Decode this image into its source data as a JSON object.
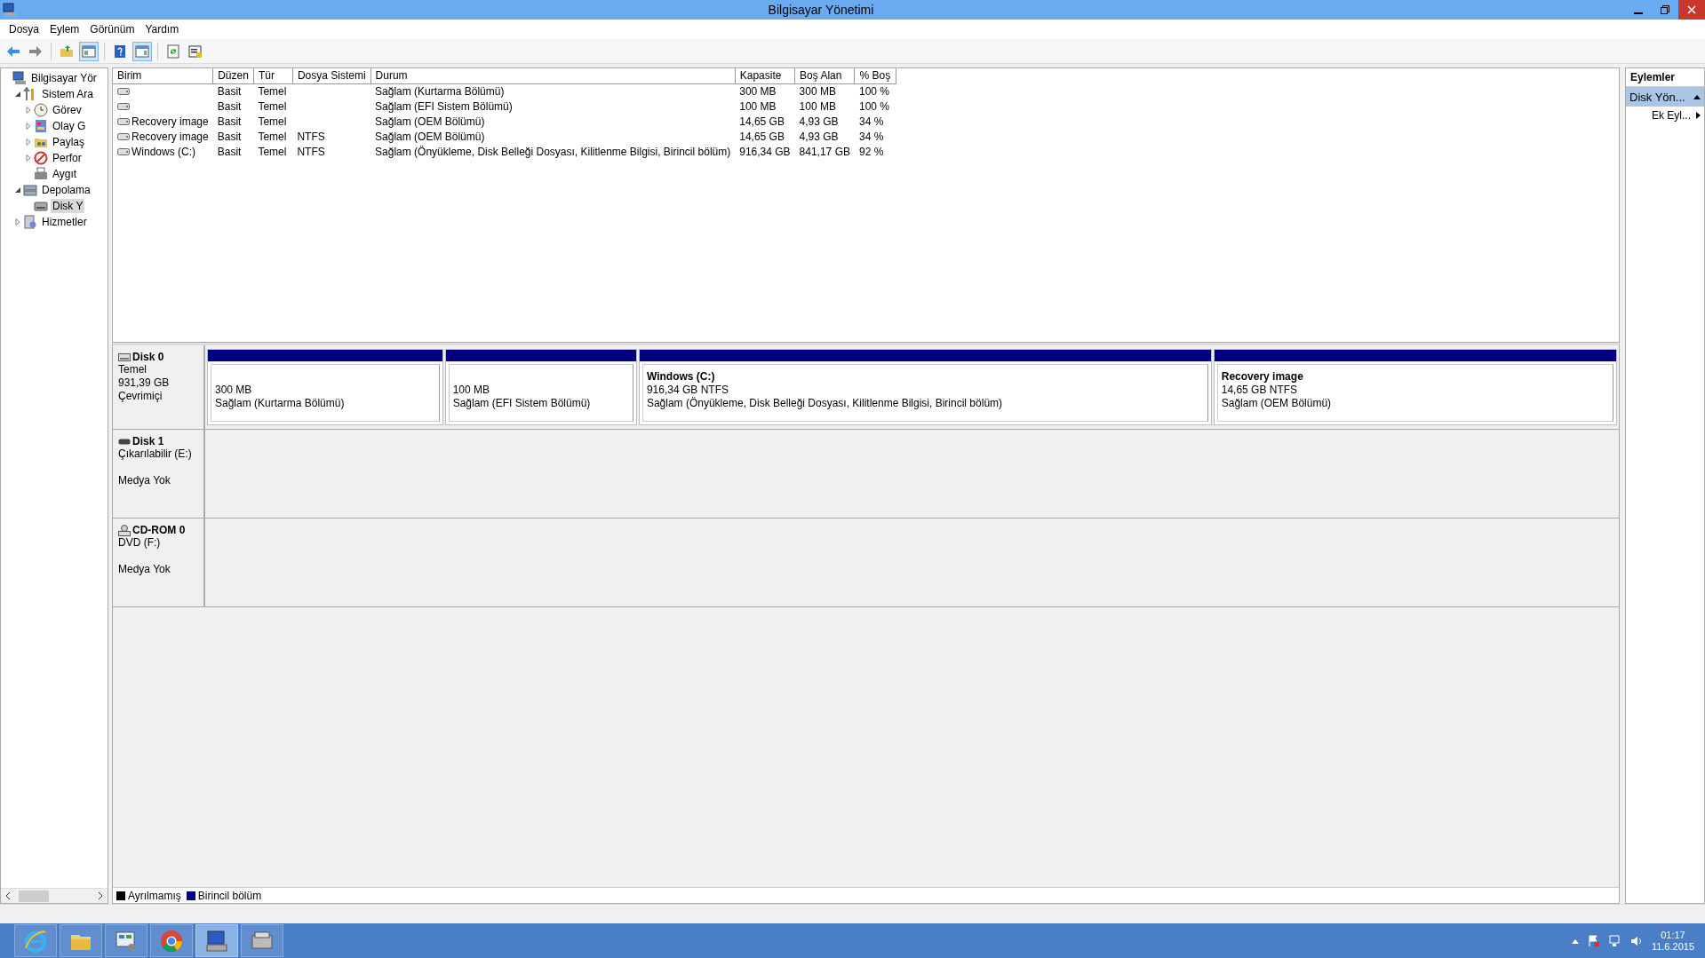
{
  "window": {
    "title": "Bilgisayar Yönetimi"
  },
  "menu": [
    "Dosya",
    "Eylem",
    "Görünüm",
    "Yardım"
  ],
  "toolbar": [
    {
      "kind": "back",
      "pressed": false
    },
    {
      "kind": "forward",
      "pressed": false
    },
    {
      "kind": "up",
      "pressed": false
    },
    {
      "kind": "tree",
      "pressed": true
    },
    {
      "kind": "help",
      "pressed": false
    },
    {
      "kind": "pane",
      "pressed": true
    },
    {
      "kind": "refresh",
      "pressed": false
    },
    {
      "kind": "props",
      "pressed": false
    }
  ],
  "tree": [
    {
      "label": "Bilgisayar Yör",
      "kind": "computer",
      "selected": false,
      "children": [
        {
          "label": "Sistem Ara",
          "kind": "tools",
          "expanded": true,
          "selected": false,
          "children": [
            {
              "label": "Görev",
              "kind": "clock",
              "expanded": false,
              "selected": false
            },
            {
              "label": "Olay G",
              "kind": "log",
              "expanded": false,
              "selected": false
            },
            {
              "label": "Paylaş",
              "kind": "share",
              "expanded": false,
              "selected": false
            },
            {
              "label": "Perfor",
              "kind": "perf",
              "expanded": false,
              "selected": false
            },
            {
              "label": "Aygıt",
              "kind": "device",
              "selected": false
            }
          ]
        },
        {
          "label": "Depolama",
          "kind": "storage",
          "expanded": true,
          "selected": false,
          "children": [
            {
              "label": "Disk Y",
              "kind": "disk",
              "selected": true
            }
          ]
        },
        {
          "label": "Hizmetler",
          "kind": "services",
          "expanded": false,
          "selected": false
        }
      ]
    }
  ],
  "volumes": {
    "columns": [
      "Birim",
      "Düzen",
      "Tür",
      "Dosya Sistemi",
      "Durum",
      "Kapasite",
      "Boş Alan",
      "% Boş"
    ],
    "rows": [
      [
        "",
        "Basit",
        "Temel",
        "",
        "Sağlam (Kurtarma Bölümü)",
        "300 MB",
        "300 MB",
        "100 %"
      ],
      [
        "",
        "Basit",
        "Temel",
        "",
        "Sağlam (EFI Sistem Bölümü)",
        "100 MB",
        "100 MB",
        "100 %"
      ],
      [
        "Recovery image",
        "Basit",
        "Temel",
        "",
        "Sağlam (OEM Bölümü)",
        "14,65 GB",
        "4,93 GB",
        "34 %"
      ],
      [
        "Recovery image",
        "Basit",
        "Temel",
        "NTFS",
        "Sağlam (OEM Bölümü)",
        "14,65 GB",
        "4,93 GB",
        "34 %"
      ],
      [
        "Windows (C:)",
        "Basit",
        "Temel",
        "NTFS",
        "Sağlam (Önyükleme, Disk Belleği Dosyası, Kilitlenme Bilgisi, Birincil bölüm)",
        "916,34 GB",
        "841,17 GB",
        "92 %"
      ]
    ]
  },
  "disks": [
    {
      "name": "Disk 0",
      "kind": "disk",
      "lines": [
        "Temel",
        "931,39 GB",
        "Çevrimiçi"
      ],
      "partitions": [
        {
          "size": "300 MB",
          "status": "Sağlam (Kurtarma Bölümü)",
          "color": "#000080"
        },
        {
          "size": "100 MB",
          "status": "Sağlam (EFI Sistem Bölümü)",
          "color": "#000080"
        },
        {
          "title": "Windows  (C:)",
          "size": "916,34 GB NTFS",
          "status": "Sağlam (Önyükleme, Disk Belleği Dosyası, Kilitlenme Bilgisi, Birincil bölüm)",
          "color": "#000080"
        },
        {
          "title": "Recovery image",
          "size": "14,65 GB NTFS",
          "status": "Sağlam (OEM Bölümü)",
          "color": "#000080"
        }
      ]
    },
    {
      "name": "Disk 1",
      "kind": "removable",
      "lines": [
        "Çıkarılabilir (E:)"
      ],
      "status": "Medya Yok"
    },
    {
      "name": "CD-ROM 0",
      "kind": "cdrom",
      "lines": [
        "DVD (F:)"
      ],
      "status": "Medya Yok"
    }
  ],
  "legend": [
    {
      "label": "Ayrılmamış",
      "color": "#000000"
    },
    {
      "label": "Birincil bölüm",
      "color": "#000080"
    }
  ],
  "actions": {
    "header": "Eylemler",
    "section": {
      "label": "Disk Yön...",
      "expanded": true
    },
    "items": [
      "Ek Eyl..."
    ]
  },
  "taskbar": [
    {
      "kind": "ie",
      "active": false
    },
    {
      "kind": "explorer",
      "active": false
    },
    {
      "kind": "control",
      "active": false
    },
    {
      "kind": "chrome",
      "active": false
    },
    {
      "kind": "compmgmt",
      "active": true
    },
    {
      "kind": "drive",
      "active": false
    }
  ],
  "clock": {
    "time": "01:17",
    "date": "11.6.2015"
  }
}
